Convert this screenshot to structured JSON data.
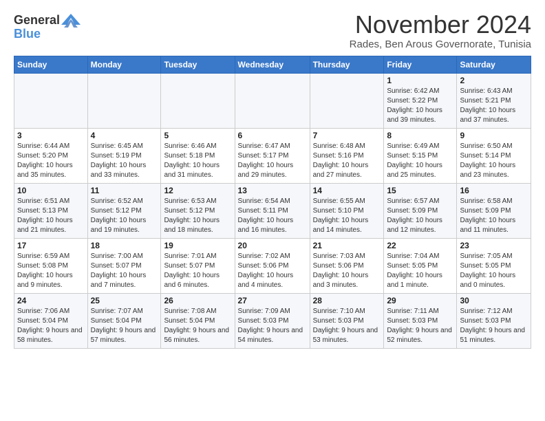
{
  "logo": {
    "line1": "General",
    "line2": "Blue"
  },
  "title": "November 2024",
  "subtitle": "Rades, Ben Arous Governorate, Tunisia",
  "headers": [
    "Sunday",
    "Monday",
    "Tuesday",
    "Wednesday",
    "Thursday",
    "Friday",
    "Saturday"
  ],
  "weeks": [
    [
      {
        "day": "",
        "info": ""
      },
      {
        "day": "",
        "info": ""
      },
      {
        "day": "",
        "info": ""
      },
      {
        "day": "",
        "info": ""
      },
      {
        "day": "",
        "info": ""
      },
      {
        "day": "1",
        "info": "Sunrise: 6:42 AM\nSunset: 5:22 PM\nDaylight: 10 hours\nand 39 minutes."
      },
      {
        "day": "2",
        "info": "Sunrise: 6:43 AM\nSunset: 5:21 PM\nDaylight: 10 hours\nand 37 minutes."
      }
    ],
    [
      {
        "day": "3",
        "info": "Sunrise: 6:44 AM\nSunset: 5:20 PM\nDaylight: 10 hours\nand 35 minutes."
      },
      {
        "day": "4",
        "info": "Sunrise: 6:45 AM\nSunset: 5:19 PM\nDaylight: 10 hours\nand 33 minutes."
      },
      {
        "day": "5",
        "info": "Sunrise: 6:46 AM\nSunset: 5:18 PM\nDaylight: 10 hours\nand 31 minutes."
      },
      {
        "day": "6",
        "info": "Sunrise: 6:47 AM\nSunset: 5:17 PM\nDaylight: 10 hours\nand 29 minutes."
      },
      {
        "day": "7",
        "info": "Sunrise: 6:48 AM\nSunset: 5:16 PM\nDaylight: 10 hours\nand 27 minutes."
      },
      {
        "day": "8",
        "info": "Sunrise: 6:49 AM\nSunset: 5:15 PM\nDaylight: 10 hours\nand 25 minutes."
      },
      {
        "day": "9",
        "info": "Sunrise: 6:50 AM\nSunset: 5:14 PM\nDaylight: 10 hours\nand 23 minutes."
      }
    ],
    [
      {
        "day": "10",
        "info": "Sunrise: 6:51 AM\nSunset: 5:13 PM\nDaylight: 10 hours\nand 21 minutes."
      },
      {
        "day": "11",
        "info": "Sunrise: 6:52 AM\nSunset: 5:12 PM\nDaylight: 10 hours\nand 19 minutes."
      },
      {
        "day": "12",
        "info": "Sunrise: 6:53 AM\nSunset: 5:12 PM\nDaylight: 10 hours\nand 18 minutes."
      },
      {
        "day": "13",
        "info": "Sunrise: 6:54 AM\nSunset: 5:11 PM\nDaylight: 10 hours\nand 16 minutes."
      },
      {
        "day": "14",
        "info": "Sunrise: 6:55 AM\nSunset: 5:10 PM\nDaylight: 10 hours\nand 14 minutes."
      },
      {
        "day": "15",
        "info": "Sunrise: 6:57 AM\nSunset: 5:09 PM\nDaylight: 10 hours\nand 12 minutes."
      },
      {
        "day": "16",
        "info": "Sunrise: 6:58 AM\nSunset: 5:09 PM\nDaylight: 10 hours\nand 11 minutes."
      }
    ],
    [
      {
        "day": "17",
        "info": "Sunrise: 6:59 AM\nSunset: 5:08 PM\nDaylight: 10 hours\nand 9 minutes."
      },
      {
        "day": "18",
        "info": "Sunrise: 7:00 AM\nSunset: 5:07 PM\nDaylight: 10 hours\nand 7 minutes."
      },
      {
        "day": "19",
        "info": "Sunrise: 7:01 AM\nSunset: 5:07 PM\nDaylight: 10 hours\nand 6 minutes."
      },
      {
        "day": "20",
        "info": "Sunrise: 7:02 AM\nSunset: 5:06 PM\nDaylight: 10 hours\nand 4 minutes."
      },
      {
        "day": "21",
        "info": "Sunrise: 7:03 AM\nSunset: 5:06 PM\nDaylight: 10 hours\nand 3 minutes."
      },
      {
        "day": "22",
        "info": "Sunrise: 7:04 AM\nSunset: 5:05 PM\nDaylight: 10 hours\nand 1 minute."
      },
      {
        "day": "23",
        "info": "Sunrise: 7:05 AM\nSunset: 5:05 PM\nDaylight: 10 hours\nand 0 minutes."
      }
    ],
    [
      {
        "day": "24",
        "info": "Sunrise: 7:06 AM\nSunset: 5:04 PM\nDaylight: 9 hours\nand 58 minutes."
      },
      {
        "day": "25",
        "info": "Sunrise: 7:07 AM\nSunset: 5:04 PM\nDaylight: 9 hours\nand 57 minutes."
      },
      {
        "day": "26",
        "info": "Sunrise: 7:08 AM\nSunset: 5:04 PM\nDaylight: 9 hours\nand 56 minutes."
      },
      {
        "day": "27",
        "info": "Sunrise: 7:09 AM\nSunset: 5:03 PM\nDaylight: 9 hours\nand 54 minutes."
      },
      {
        "day": "28",
        "info": "Sunrise: 7:10 AM\nSunset: 5:03 PM\nDaylight: 9 hours\nand 53 minutes."
      },
      {
        "day": "29",
        "info": "Sunrise: 7:11 AM\nSunset: 5:03 PM\nDaylight: 9 hours\nand 52 minutes."
      },
      {
        "day": "30",
        "info": "Sunrise: 7:12 AM\nSunset: 5:03 PM\nDaylight: 9 hours\nand 51 minutes."
      }
    ]
  ]
}
